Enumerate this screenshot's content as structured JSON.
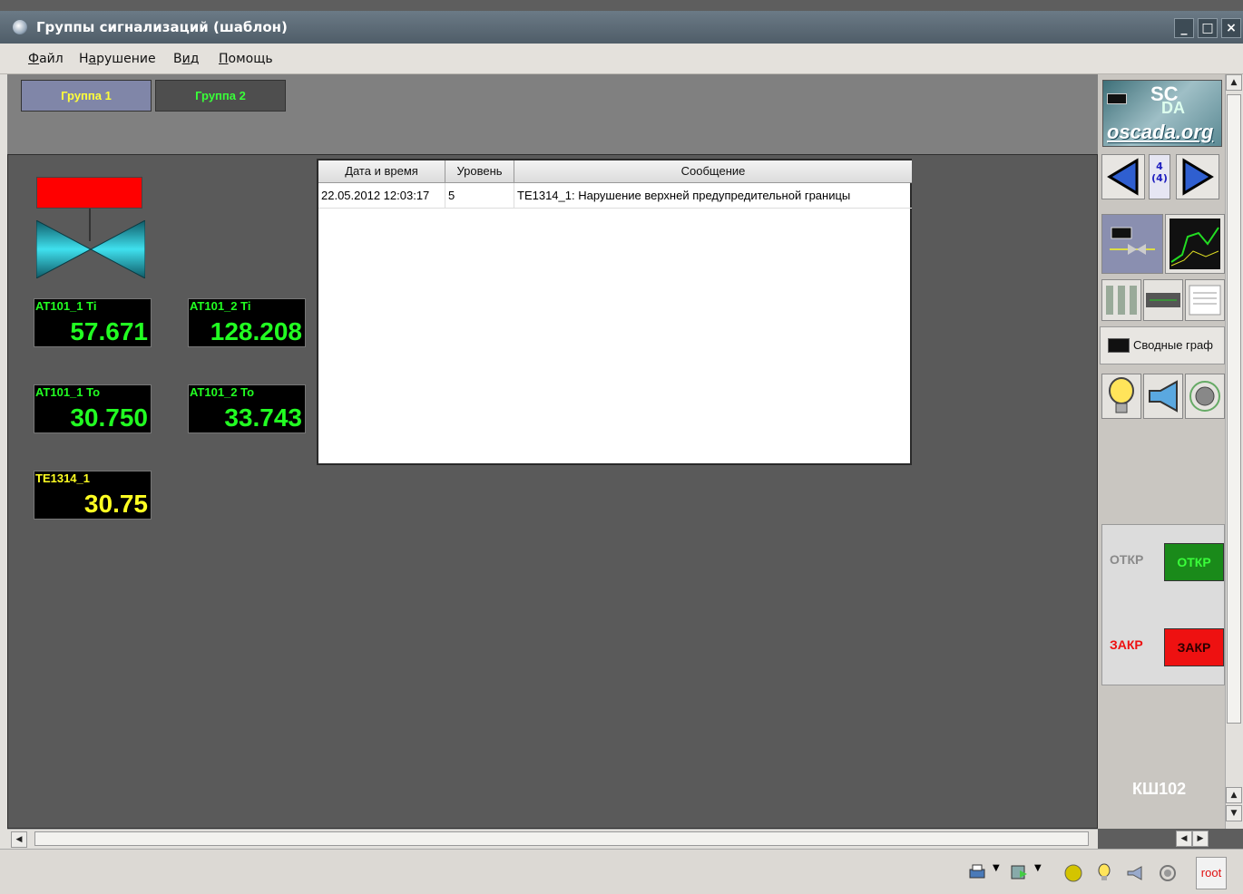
{
  "window": {
    "title": "Группы сигнализаций (шаблон)",
    "minimize": "_",
    "maximize": "□",
    "close": "×"
  },
  "menu": [
    {
      "label": "Файл"
    },
    {
      "label": "Нарушение"
    },
    {
      "label": "Вид"
    },
    {
      "label": "Помощь"
    }
  ],
  "tabs": [
    {
      "label": "Группа 1",
      "active": true
    },
    {
      "label": "Группа 2",
      "active": false
    }
  ],
  "gauges": [
    {
      "label": "AT101_1 Ti",
      "value": "57.671",
      "color": "#22ff22"
    },
    {
      "label": "AT101_2 Ti",
      "value": "128.208",
      "color": "#22ff22"
    },
    {
      "label": "AT101_1 To",
      "value": "30.750",
      "color": "#22ff22"
    },
    {
      "label": "AT101_2 To",
      "value": "33.743",
      "color": "#22ff22"
    },
    {
      "label": "TE1314_1",
      "value": "30.75",
      "color": "#ffff22"
    }
  ],
  "lamp_color": "#ff0000",
  "valve_color": "#37c9d6",
  "alarm_table": {
    "headers": [
      "Дата и время",
      "Уровень",
      "Сообщение"
    ],
    "rows": [
      [
        "22.05.2012 12:03:17",
        "5",
        "TE1314_1: Нарушение верхней предупредительной границы"
      ]
    ]
  },
  "right_panel": {
    "logo": {
      "top": "SC",
      "mid": "DA",
      "bottom": "oscada.org"
    },
    "page": {
      "current": "4",
      "total": "(4)"
    },
    "summary_label": "Сводные граф",
    "controls": {
      "open_label": "ОТКР",
      "open_button": "ОТКР",
      "close_label": "ЗАКР",
      "close_button": "ЗАКР"
    },
    "object_name": "КШ102"
  },
  "statusbar": {
    "user": "root"
  }
}
